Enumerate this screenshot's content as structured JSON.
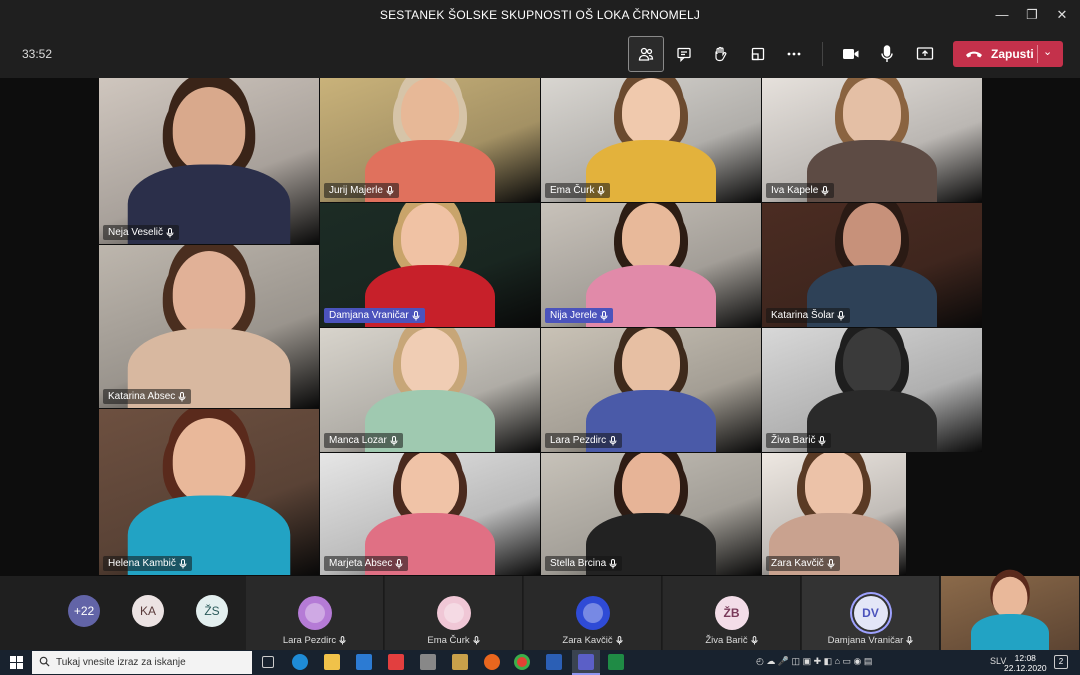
{
  "window": {
    "title": "SESTANEK ŠOLSKE SKUPNOSTI OŠ LOKA ČRNOMELJ",
    "controls": {
      "minimize": "—",
      "restore": "❐",
      "close": "✕"
    }
  },
  "toolbar": {
    "timer": "33:52",
    "hangup_label": "Zapusti"
  },
  "tiles": [
    {
      "name": "Neja Veselič",
      "bg": "#cfc6be",
      "skin": "#d9a98c",
      "hair": "#3a2418",
      "shirt": "#2b2f4a"
    },
    {
      "name": "Jurij Majerle",
      "bg": "#c9b27a",
      "skin": "#e7b897",
      "hair": "#d6c4a8",
      "shirt": "#e0715d"
    },
    {
      "name": "Ema Čurk",
      "bg": "#d9d6d1",
      "skin": "#f0c9ad",
      "hair": "#6b4a2f",
      "shirt": "#e3b23c"
    },
    {
      "name": "Iva Kapele",
      "bg": "#e6e1dc",
      "skin": "#e4bfa5",
      "hair": "#8a6340",
      "shirt": "#5d4b44"
    },
    {
      "name": "Damjana Vraničar",
      "bg": "#1c2c25",
      "skin": "#f0c2a4",
      "hair": "#c9a46a",
      "shirt": "#c7202a",
      "highlight": true
    },
    {
      "name": "Nija Jerele",
      "bg": "#c8c2ba",
      "skin": "#e8b99a",
      "hair": "#2d1d14",
      "shirt": "#e18aa9",
      "highlight": true
    },
    {
      "name": "Katarina Šolar",
      "bg": "#4b2c22",
      "skin": "#c7917a",
      "hair": "#2a1a14",
      "shirt": "#2e4157"
    },
    {
      "name": "Katarina Absec",
      "bg": "#bdb6ad",
      "skin": "#e1b197",
      "hair": "#4a2e1f",
      "shirt": "#d8b8a0"
    },
    {
      "name": "Manca Lozar",
      "bg": "#d8d4cc",
      "skin": "#f0cdb4",
      "hair": "#c7a678",
      "shirt": "#9fc9b0"
    },
    {
      "name": "Lara Pezdirc",
      "bg": "#c9c2b6",
      "skin": "#e7bfa3",
      "hair": "#3e2a1c",
      "shirt": "#4a5aa8"
    },
    {
      "name": "Živa Barič",
      "bg": "#d8d8d8",
      "skin": "#3a3a3a",
      "hair": "#1e1e1e",
      "shirt": "#2a2a2a"
    },
    {
      "name": "Helena Kambič",
      "bg": "#6d5040",
      "skin": "#e9b89a",
      "hair": "#5a2a1c",
      "shirt": "#22a3c4"
    },
    {
      "name": "Marjeta Absec",
      "bg": "#e6e6e6",
      "skin": "#f0c3a7",
      "hair": "#4a2a1e",
      "shirt": "#e07084"
    },
    {
      "name": "Stella Brcina",
      "bg": "#c7c2b9",
      "skin": "#e7b497",
      "hair": "#2e1c14",
      "shirt": "#222222"
    },
    {
      "name": "Zara Kavčič",
      "bg": "#eee8e2",
      "skin": "#ecc2a8",
      "hair": "#5a3a24",
      "shirt": "#c9a28f"
    }
  ],
  "overflow": [
    {
      "label": "+22",
      "bg": "#6264a7",
      "fg": "#ffffff"
    },
    {
      "label": "KA",
      "bg": "#ece3e3",
      "fg": "#5a3a3a"
    },
    {
      "label": "ŽS",
      "bg": "#e3efef",
      "fg": "#2a5a5a"
    }
  ],
  "participants": [
    {
      "name": "Lara Pezdirc",
      "initials": "",
      "bg": "#b57bd6"
    },
    {
      "name": "Ema Čurk",
      "initials": "",
      "bg": "#f0c7d6"
    },
    {
      "name": "Zara Kavčič",
      "initials": "",
      "bg": "#2f4bd6"
    },
    {
      "name": "Živa Barič",
      "initials": "ŽB",
      "bg": "#f3dde8",
      "fg": "#7a3a5a"
    },
    {
      "name": "Damjana Vraničar",
      "initials": "DV",
      "bg": "#e3e6f7",
      "fg": "#4b53bc"
    }
  ],
  "taskbar": {
    "search_placeholder": "Tukaj vnesite izraz za iskanje",
    "language": "SLV",
    "time": "12:08",
    "date": "22.12.2020",
    "notifications": "2"
  }
}
